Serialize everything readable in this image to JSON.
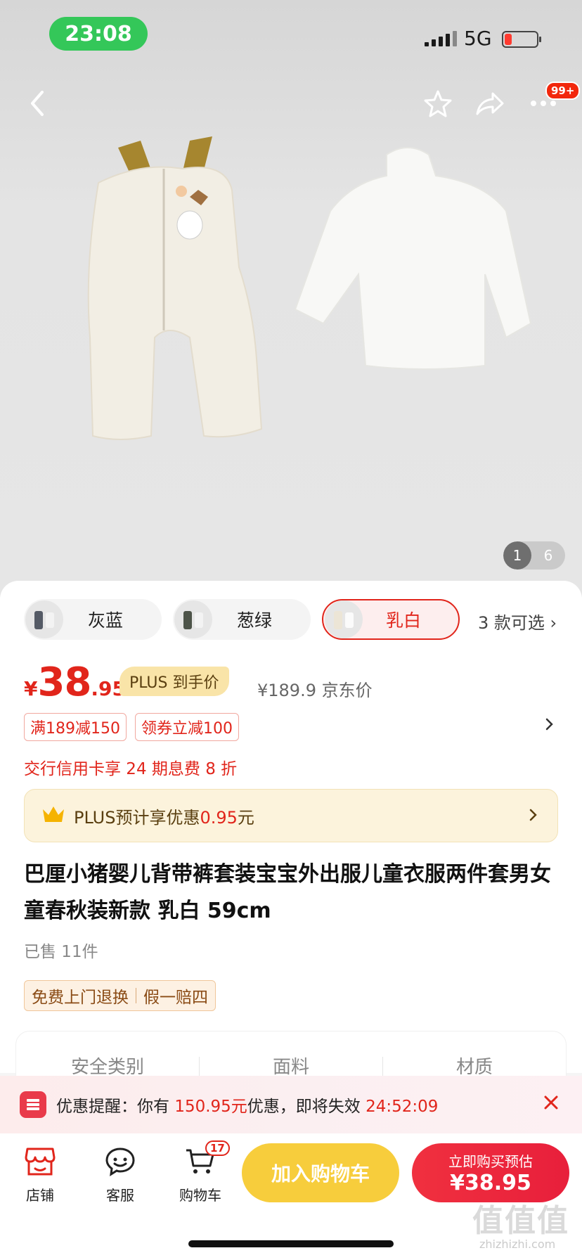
{
  "status": {
    "time": "23:08",
    "network": "5G"
  },
  "nav": {
    "cart_badge": "99+",
    "icons": [
      "back-icon",
      "star-icon",
      "share-icon",
      "more-icon"
    ]
  },
  "gallery": {
    "current": "1",
    "total": "6"
  },
  "variants": {
    "items": [
      {
        "label": "灰蓝",
        "selected": false
      },
      {
        "label": "葱绿",
        "selected": false
      },
      {
        "label": "乳白",
        "selected": true
      }
    ],
    "more": "3 款可选 ›"
  },
  "price": {
    "currency": "¥",
    "integer": "38",
    "decimal": ".95",
    "plus_tag": "PLUS 到手价",
    "jd_price": "¥189.9 京东价"
  },
  "promos": [
    "满189减150",
    "领券立减100"
  ],
  "credit_line": "交行信用卡享 24 期息费 8 折",
  "plus_banner": {
    "prefix": "PLUS预计享优惠",
    "amount": "0.95",
    "suffix": "元"
  },
  "product": {
    "title": "巴厘小猪婴儿背带裤套装宝宝外出服儿童衣服两件套男女童春秋装新款 乳白 59cm",
    "sold": "已售 11件"
  },
  "service_tags": [
    "免费上门退换",
    "假一赔四"
  ],
  "specs": [
    "安全类别",
    "面料",
    "材质"
  ],
  "reminder": {
    "prefix": "优惠提醒：你有 ",
    "amount": "150.95元",
    "middle": "优惠，即将失效 ",
    "countdown": "24:52:09"
  },
  "bottom": {
    "store": "店铺",
    "service": "客服",
    "cart": "购物车",
    "cart_count": "17",
    "add_to_cart": "加入购物车",
    "buy_line1": "立即购买预估",
    "buy_line2": "¥38.95"
  },
  "watermark": {
    "main": "值值值",
    "sub": "zhizhizhi.com"
  },
  "colors": {
    "accent_red": "#e1251b",
    "yellow": "#f7cd3c",
    "plus_gold": "#f9e4a8"
  }
}
